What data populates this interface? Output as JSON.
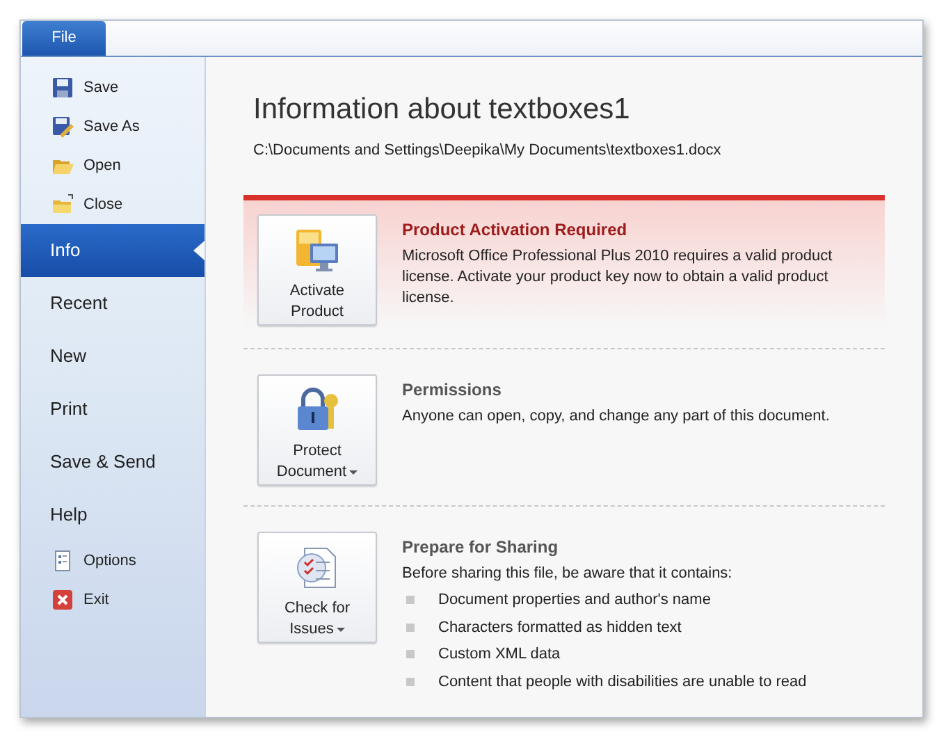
{
  "file_tab": {
    "label": "File"
  },
  "sidebar": {
    "items": [
      {
        "label": "Save",
        "kind": "command",
        "selected": false
      },
      {
        "label": "Save As",
        "kind": "command",
        "selected": false
      },
      {
        "label": "Open",
        "kind": "command",
        "selected": false
      },
      {
        "label": "Close",
        "kind": "command",
        "selected": false
      },
      {
        "label": "Info",
        "kind": "page",
        "selected": true
      },
      {
        "label": "Recent",
        "kind": "page",
        "selected": false
      },
      {
        "label": "New",
        "kind": "page",
        "selected": false
      },
      {
        "label": "Print",
        "kind": "page",
        "selected": false
      },
      {
        "label": "Save & Send",
        "kind": "page",
        "selected": false
      },
      {
        "label": "Help",
        "kind": "page",
        "selected": false
      },
      {
        "label": "Options",
        "kind": "command",
        "selected": false
      },
      {
        "label": "Exit",
        "kind": "command",
        "selected": false
      }
    ]
  },
  "header": {
    "title": "Information about textboxes1",
    "path": "C:\\Documents and Settings\\Deepika\\My Documents\\textboxes1.docx"
  },
  "sections": [
    {
      "kind": "alert",
      "button": {
        "lines": [
          "Activate",
          "Product"
        ],
        "dropdown": false
      },
      "title": "Product Activation Required",
      "description": "Microsoft Office Professional Plus 2010 requires a valid product license. Activate your product key now to obtain a valid product license."
    },
    {
      "kind": "normal",
      "button": {
        "lines": [
          "Protect",
          "Document"
        ],
        "dropdown": true
      },
      "title": "Permissions",
      "description": "Anyone can open, copy, and change any part of this document."
    },
    {
      "kind": "normal",
      "button": {
        "lines": [
          "Check for",
          "Issues"
        ],
        "dropdown": true
      },
      "title": "Prepare for Sharing",
      "description": "Before sharing this file, be aware that it contains:",
      "bullets": [
        "Document properties and author's name",
        "Characters formatted as hidden text",
        "Custom XML data",
        "Content that people with disabilities are unable to read"
      ]
    }
  ]
}
